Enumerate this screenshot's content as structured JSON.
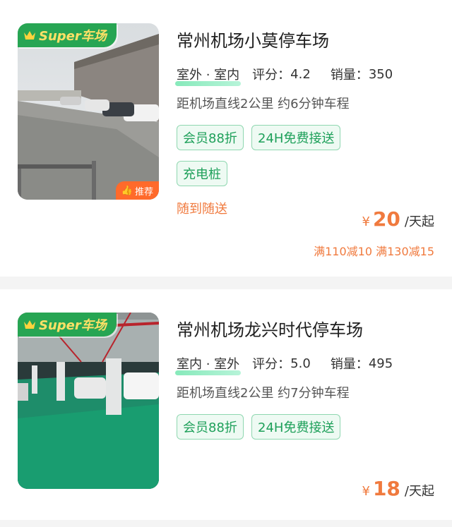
{
  "listings": [
    {
      "badge": "Super车场",
      "recommend": "推荐",
      "name": "常州机场小莫停车场",
      "location_type": "室外 · 室内",
      "rating_label": "评分：",
      "rating": "4.2",
      "sales_label": "销量：",
      "sales": "350",
      "distance": "距机场直线2公里 约6分钟车程",
      "tags": [
        "会员88折",
        "24H免费接送",
        "充电桩"
      ],
      "note": "随到随送",
      "price_symbol": "¥",
      "price": "20",
      "price_unit": "/天起",
      "promo": "满110减10 满130减15"
    },
    {
      "badge": "Super车场",
      "name": "常州机场龙兴时代停车场",
      "location_type": "室内 · 室外",
      "rating_label": "评分：",
      "rating": "5.0",
      "sales_label": "销量：",
      "sales": "495",
      "distance": "距机场直线2公里 约7分钟车程",
      "tags": [
        "会员88折",
        "24H免费接送"
      ],
      "price_symbol": "¥",
      "price": "18",
      "price_unit": "/天起"
    }
  ],
  "colors": {
    "brand_green": "#27a553",
    "tag_green": "#1ea05a",
    "price_orange": "#f07a3e",
    "recommend_orange": "#ff6a2b"
  }
}
